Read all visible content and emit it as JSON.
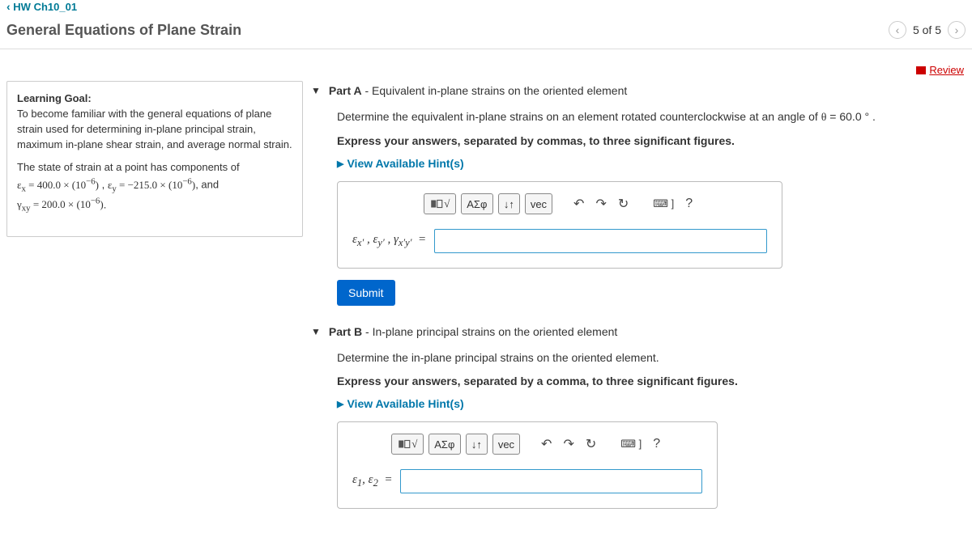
{
  "nav": {
    "back_label": "HW Ch10_01",
    "page_title": "General Equations of Plane Strain",
    "pager_text": "5 of 5",
    "review_label": "Review"
  },
  "sidebar": {
    "learning_goal_label": "Learning Goal:",
    "learning_goal_text": "To become familiar with the general equations of plane strain used for determining in-plane principal strain, maximum in-plane shear strain, and average normal strain.",
    "state_intro": "The state of strain at a point has components of",
    "ex_val": "ε_x = 400.0 × (10⁻⁶)",
    "ey_val": "ε_y = −215.0 × (10⁻⁶)",
    "gxy_val": "γ_xy = 200.0 × (10⁻⁶)",
    "and_label": ", and"
  },
  "partA": {
    "header_bold": "Part A",
    "header_rest": " - Equivalent in-plane strains on the oriented element",
    "desc_pre": "Determine the equivalent in-plane strains on an element rotated counterclockwise at an angle of ",
    "desc_angle": "θ = 60.0 °",
    "desc_post": " .",
    "instruction": "Express your answers, separated by commas, to three significant figures.",
    "hints_label": "View Available Hint(s)",
    "answer_label": "ε_x′ , ε_y′ , γ_x′y′  =",
    "submit_label": "Submit"
  },
  "partB": {
    "header_bold": "Part B",
    "header_rest": " - In-plane principal strains on the oriented element",
    "desc": "Determine the in-plane principal strains on the oriented element.",
    "instruction": "Express your answers, separated by a comma, to three significant figures.",
    "hints_label": "View Available Hint(s)",
    "answer_label": "ε₁, ε₂  ="
  },
  "toolbar": {
    "template_label": "√x",
    "greek_label": "ΑΣφ",
    "subsup_label": "↓↑",
    "vec_label": "vec",
    "undo_icon": "↶",
    "redo_icon": "↷",
    "reset_icon": "↻",
    "keyboard_icon": "⌨ ]",
    "help_icon": "?"
  }
}
